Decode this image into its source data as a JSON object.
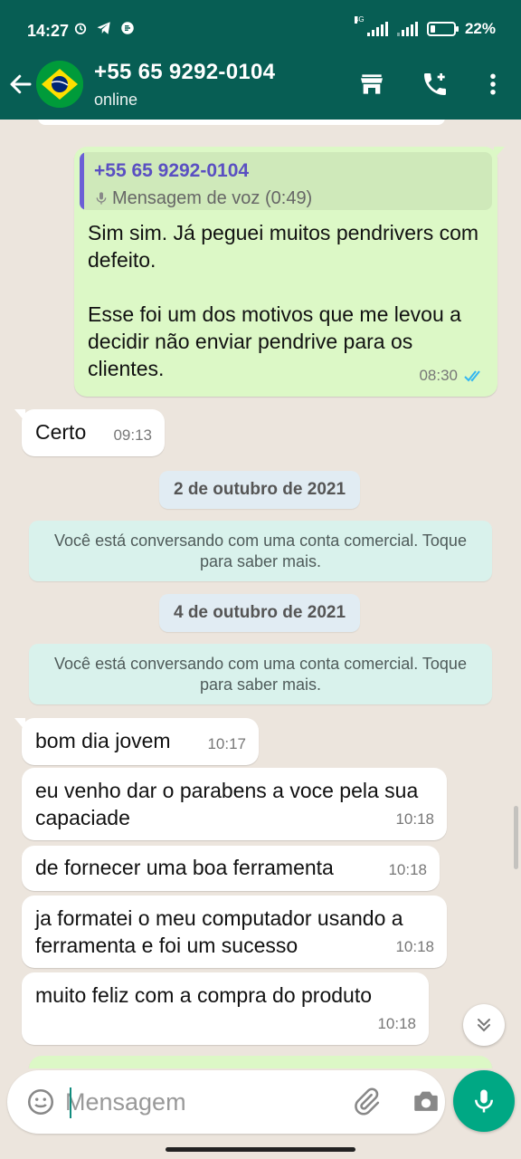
{
  "status_bar": {
    "time": "14:27",
    "network": "4G",
    "battery_text": "22%",
    "battery_level": 0.22
  },
  "header": {
    "contact_name": "+55 65 9292-0104",
    "status": "online",
    "avatar": "brazil-flag",
    "actions": [
      "shop-icon",
      "add-call-icon",
      "more-vert-icon"
    ]
  },
  "messages": [
    {
      "direction": "out",
      "quote": {
        "name": "+55 65 9292-0104",
        "text": "Mensagem de voz (0:49)"
      },
      "text": "Sim sim. Já peguei muitos pendrivers com defeito.\n\nEsse foi um dos motivos que me levou a decidir não enviar pendrive para os clientes.",
      "time": "08:30",
      "read": true
    },
    {
      "direction": "in",
      "text": "Certo",
      "time": "09:13"
    }
  ],
  "date_1": "2 de outubro de 2021",
  "notice_1": "Você está conversando com uma conta comercial. Toque para saber mais.",
  "date_2": "4 de outubro de 2021",
  "notice_2": "Você está conversando com uma conta comercial. Toque para saber mais.",
  "messages_2": [
    {
      "direction": "in",
      "text": "bom dia jovem",
      "time": "10:17"
    },
    {
      "direction": "in",
      "text": "eu venho dar o parabens a voce pela sua capaciade",
      "time": "10:18"
    },
    {
      "direction": "in",
      "text": "de fornecer uma boa ferramenta",
      "time": "10:18"
    },
    {
      "direction": "in",
      "text": "ja formatei o meu computador usando a ferramenta e foi um sucesso",
      "time": "10:18"
    },
    {
      "direction": "in",
      "text": "muito feliz com a compra do produto",
      "time": "10:18"
    }
  ],
  "input": {
    "placeholder": "Mensagem"
  },
  "colors": {
    "header": "#075e54",
    "chat_bg": "#ece5dd",
    "outgoing": "#dcf8c6",
    "incoming": "#ffffff",
    "mic": "#00a884",
    "read_ticks": "#34b7f1"
  }
}
